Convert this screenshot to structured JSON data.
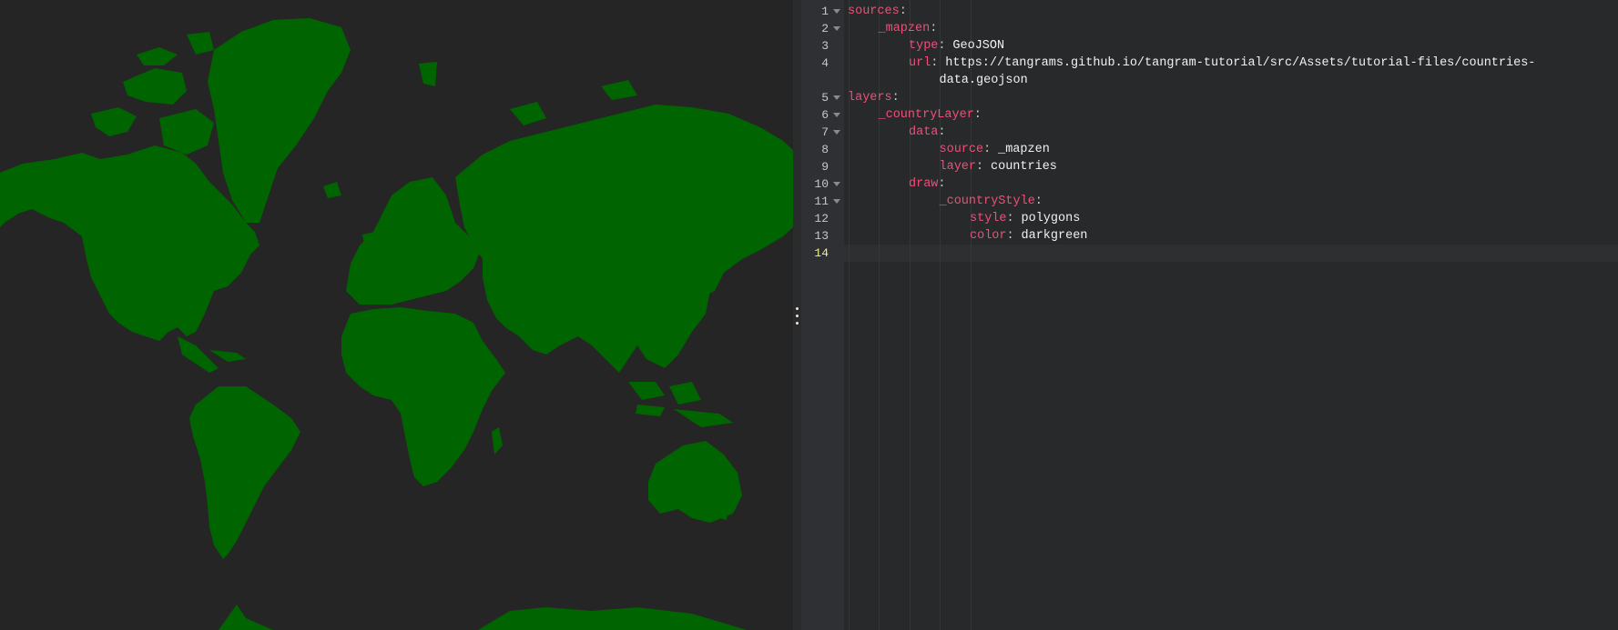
{
  "map": {
    "land_color": "#006400",
    "background_color": "#252525"
  },
  "editor": {
    "lines": [
      {
        "num": "1",
        "fold": true,
        "key": "sources",
        "value": ""
      },
      {
        "num": "2",
        "fold": true,
        "key": "_mapzen",
        "value": ""
      },
      {
        "num": "3",
        "fold": false,
        "key": "type",
        "value": "GeoJSON"
      },
      {
        "num": "4",
        "fold": false,
        "key": "url",
        "value": "https://tangrams.github.io/tangram-tutorial/src/Assets/tutorial-files/countries-",
        "wrap": "data.geojson"
      },
      {
        "num": "5",
        "fold": true,
        "key": "layers",
        "value": ""
      },
      {
        "num": "6",
        "fold": true,
        "key": "_countryLayer",
        "value": ""
      },
      {
        "num": "7",
        "fold": true,
        "key": "data",
        "value": ""
      },
      {
        "num": "8",
        "fold": false,
        "key": "source",
        "value": "_mapzen"
      },
      {
        "num": "9",
        "fold": false,
        "key": "layer",
        "value": "countries"
      },
      {
        "num": "10",
        "fold": true,
        "key": "draw",
        "value": ""
      },
      {
        "num": "11",
        "fold": true,
        "key": "_countryStyle",
        "value": ""
      },
      {
        "num": "12",
        "fold": false,
        "key": "style",
        "value": "polygons"
      },
      {
        "num": "13",
        "fold": false,
        "key": "color",
        "value": "darkgreen"
      },
      {
        "num": "14",
        "fold": false,
        "key": "",
        "value": "",
        "active": true
      }
    ],
    "colors": {
      "key": "#ef4f79",
      "value": "#f1f1f1",
      "active_line_number": "#f3f07a"
    }
  }
}
